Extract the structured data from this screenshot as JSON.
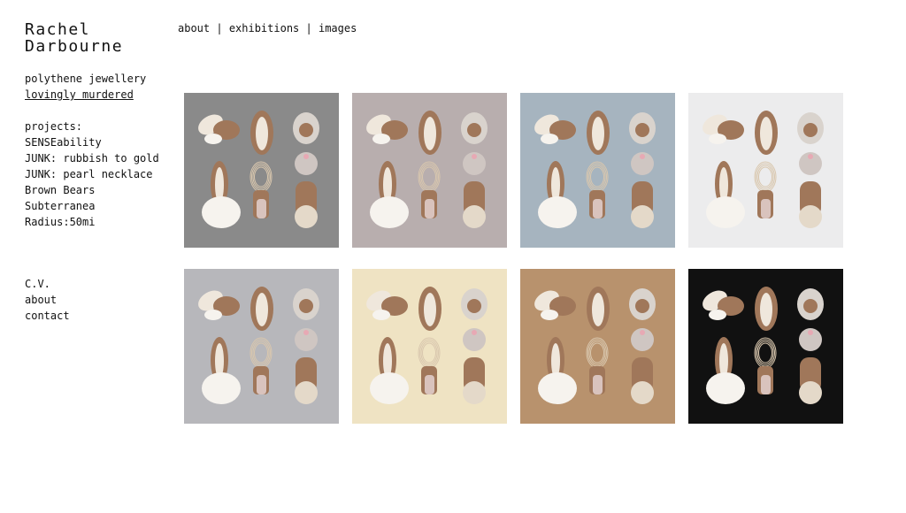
{
  "site": {
    "title_line1": "Rachel",
    "title_line2": "Darbourne"
  },
  "tagline": {
    "line1": "polythene jewellery",
    "line2": "lovingly murdered"
  },
  "top_nav": {
    "about": "about",
    "sep1": " | ",
    "exhibitions": "exhibitions",
    "sep2": " | ",
    "images": "images"
  },
  "projects": {
    "heading": "projects:",
    "items": [
      "SENSEability",
      "JUNK: rubbish to gold",
      "JUNK: pearl necklace",
      "Brown Bears",
      "Subterranea",
      "Radius:50mi"
    ]
  },
  "footer_nav": {
    "items": [
      "C.V.",
      "about",
      "contact"
    ]
  },
  "gallery": {
    "backgrounds": [
      "#8a8a8a",
      "#b8aeae",
      "#a6b4bf",
      "#ececed",
      "#b7b7bb",
      "#efe3c3",
      "#b8926d",
      "#111111"
    ]
  }
}
